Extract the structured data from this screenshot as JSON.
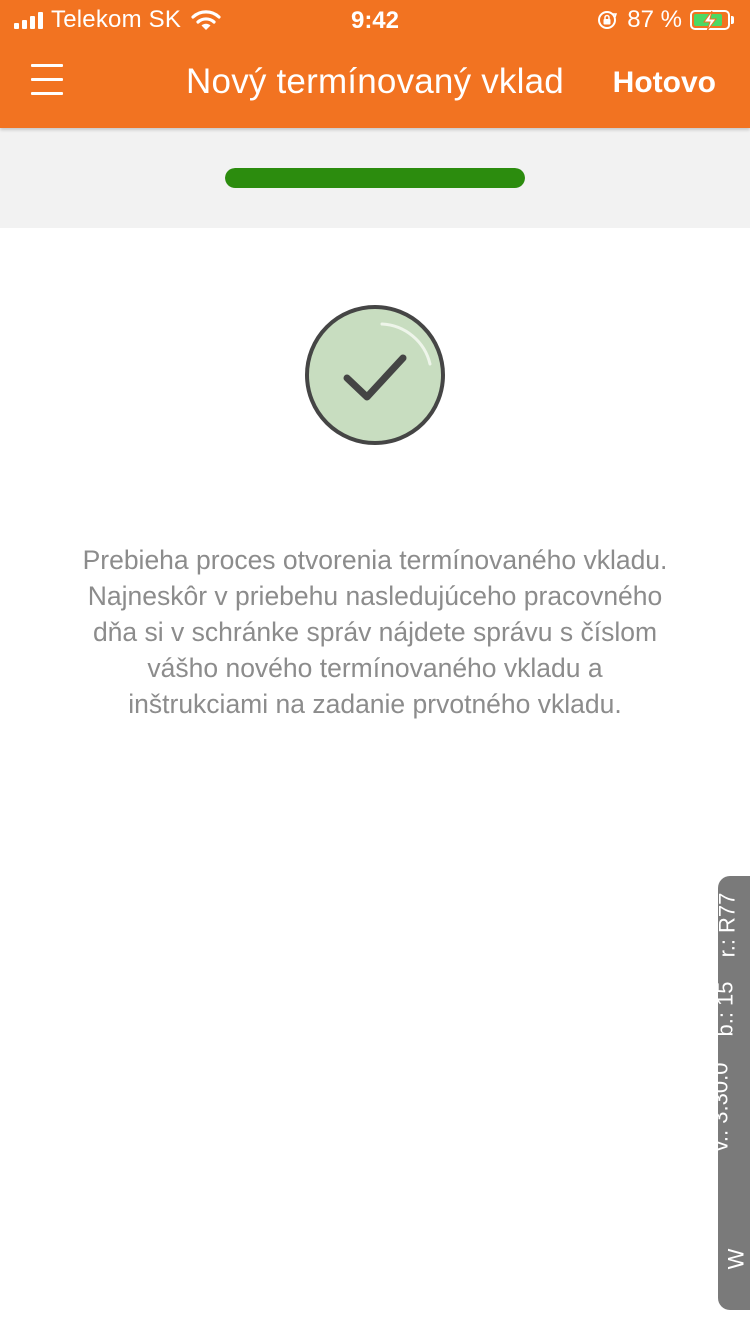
{
  "status_bar": {
    "carrier": "Telekom SK",
    "time": "9:42",
    "battery_percent": "87 %",
    "battery_level": 0.87,
    "icons": [
      "cellular-signal-icon",
      "wifi-icon",
      "rotation-lock-icon",
      "battery-charging-icon"
    ]
  },
  "nav": {
    "menu_icon": "hamburger-menu-icon",
    "title": "Nový termínovaný vklad",
    "done_label": "Hotovo"
  },
  "progress": {
    "value": 1.0,
    "color": "#2c8c0e"
  },
  "result": {
    "icon": "checkmark-circle-icon",
    "message": "Prebieha proces otvorenia termínovaného vkladu. Najneskôr v priebehu nasledujúceho pracovného dňa si v schránke správ nájdete správu s číslom vášho nového termínovaného vkladu a inštrukciami na zadanie prvotného vkladu."
  },
  "version_info": {
    "w": "W",
    "version": "v.: 3.30.0",
    "build": "b.: 15",
    "revision": "r.: R77"
  },
  "colors": {
    "header": "#f27321",
    "progress": "#2c8c0e",
    "check_circle": "#c8ddc0",
    "message_text": "#8c8c8c",
    "version_tab": "#7a7a7a"
  }
}
